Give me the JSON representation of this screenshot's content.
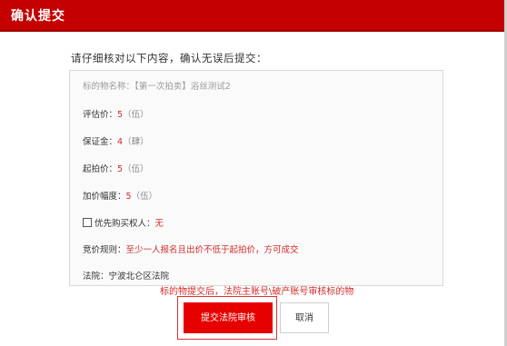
{
  "modal": {
    "title": "确认提交",
    "intro": "请仔细核对以下内容，确认无误后提交："
  },
  "details": {
    "subject_label": "标的物名称：",
    "subject_value": "【第一次拍卖】浴丝测试2",
    "appraisal_label": "评估价：",
    "appraisal_value": "5",
    "appraisal_cn": "（伍）",
    "deposit_label": "保证金：",
    "deposit_value": "4",
    "deposit_cn": "（肆）",
    "start_label": "起拍价：",
    "start_value": "5",
    "start_cn": "（伍）",
    "increment_label": "加价幅度：",
    "increment_value": "5",
    "increment_cn": "（伍）",
    "priority_label": "优先购买权人：",
    "priority_value": "无",
    "rule_label": "竞价规则：",
    "rule_value": "至少一人报名且出价不低于起拍价，方可成交",
    "court_label": "法院：",
    "court_value": "宁波北仑区法院"
  },
  "notice": "标的物提交后，法院主账号\\破产账号审核标的物",
  "buttons": {
    "submit": "提交法院审核",
    "cancel": "取消"
  }
}
